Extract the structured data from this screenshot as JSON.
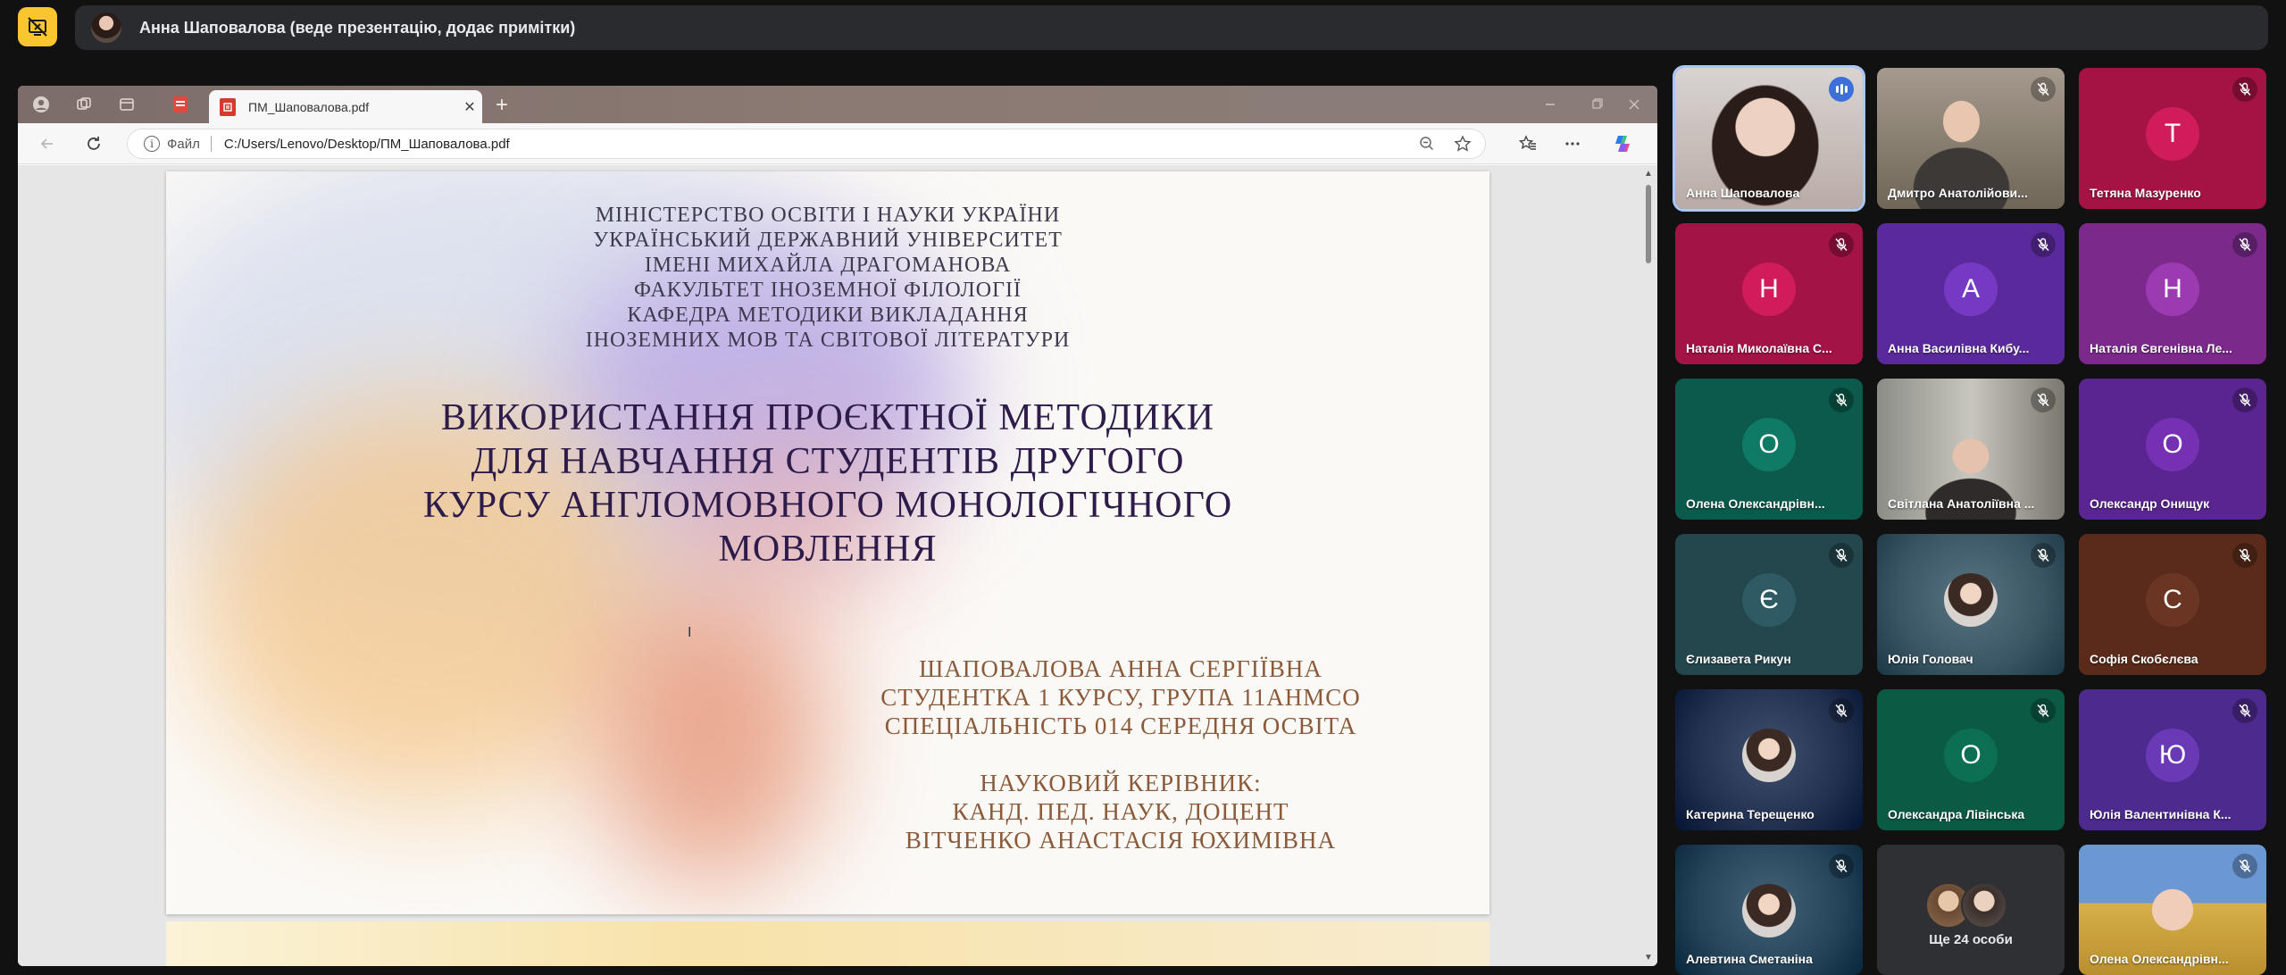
{
  "presenter_bar": {
    "text": "Анна Шаповалова (веде презентацію, додає примітки)"
  },
  "browser": {
    "tab_title": "ПМ_Шаповалова.pdf",
    "tab_close": "✕",
    "new_tab": "+",
    "address": {
      "scheme_label": "Файл",
      "url": "C:/Users/Lenovo/Desktop/ПМ_Шаповалова.pdf"
    }
  },
  "pdf": {
    "institution_lines": [
      "МІНІСТЕРСТВО ОСВІТИ І НАУКИ УКРАЇНИ",
      "УКРАЇНСЬКИЙ ДЕРЖАВНИЙ УНІВЕРСИТЕТ",
      "ІМЕНІ МИХАЙЛА ДРАГОМАНОВА",
      "ФАКУЛЬТЕТ ІНОЗЕМНОЇ ФІЛОЛОГІЇ",
      "КАФЕДРА МЕТОДИКИ ВИКЛАДАННЯ",
      "ІНОЗЕМНИХ МОВ ТА СВІТОВОЇ ЛІТЕРАТУРИ"
    ],
    "title_lines": [
      "ВИКОРИСТАННЯ ПРОЄКТНОЇ МЕТОДИКИ",
      "ДЛЯ НАВЧАННЯ СТУДЕНТІВ ДРУГОГО",
      "КУРСУ АНГЛОМОВНОГО МОНОЛОГІЧНОГО",
      "МОВЛЕННЯ"
    ],
    "author_lines": [
      "ШАПОВАЛОВА АННА СЕРГІЇВНА",
      "СТУДЕНТКА 1 КУРСУ, ГРУПА 11АНМСО",
      "СПЕЦІАЛЬНІСТЬ 014 СЕРЕДНЯ ОСВІТА"
    ],
    "supervisor_lines": [
      "НАУКОВИЙ КЕРІВНИК:",
      "КАНД. ПЕД. НАУК, ДОЦЕНТ",
      "ВІТЧЕНКО АНАСТАСІЯ ЮХИМІВНА"
    ]
  },
  "participants": [
    {
      "name": "Анна Шаповалова",
      "initial": "",
      "bg": "#c8bdb6",
      "speaking": true,
      "muted": false
    },
    {
      "name": "Дмитро Анатолійови...",
      "initial": "",
      "bg": "#8c8478",
      "speaking": false,
      "muted": true
    },
    {
      "name": "Тетяна Мазуренко",
      "initial": "Т",
      "bg": "#a41344",
      "avatar_bg": "#d01c5a",
      "speaking": false,
      "muted": true
    },
    {
      "name": "Наталія Миколаївна С...",
      "initial": "Н",
      "bg": "#a31346",
      "avatar_bg": "#d01c5a",
      "speaking": false,
      "muted": true
    },
    {
      "name": "Анна Василівна Кибу...",
      "initial": "А",
      "bg": "#5a2a9c",
      "avatar_bg": "#7639c4",
      "speaking": false,
      "muted": true
    },
    {
      "name": "Наталія Євгенівна Ле...",
      "initial": "Н",
      "bg": "#7b2a8c",
      "avatar_bg": "#9c3ab2",
      "speaking": false,
      "muted": true
    },
    {
      "name": "Олена Олександрівн...",
      "initial": "О",
      "bg": "#0b5a4c",
      "avatar_bg": "#0f7a66",
      "speaking": false,
      "muted": true
    },
    {
      "name": "Світлана Анатоліївна ...",
      "initial": "",
      "bg": "#6e6a66",
      "speaking": false,
      "muted": true
    },
    {
      "name": "Олександр Онищук",
      "initial": "О",
      "bg": "#5a2590",
      "avatar_bg": "#7530b4",
      "speaking": false,
      "muted": true
    },
    {
      "name": "Єлизавета Рикун",
      "initial": "Є",
      "bg": "#24474e",
      "avatar_bg": "#2e5b63",
      "speaking": false,
      "muted": true
    },
    {
      "name": "Юлія Головач",
      "initial": "",
      "bg": "#3a5563",
      "speaking": false,
      "muted": true
    },
    {
      "name": "Софія Скобєлєва",
      "initial": "С",
      "bg": "#5a2b1a",
      "avatar_bg": "#6b3524",
      "speaking": false,
      "muted": true
    },
    {
      "name": "Катерина Терещенко",
      "initial": "",
      "bg": "#233150",
      "speaking": false,
      "muted": true
    },
    {
      "name": "Олександра Лівінська",
      "initial": "О",
      "bg": "#0a5a44",
      "avatar_bg": "#0c6e53",
      "speaking": false,
      "muted": true
    },
    {
      "name": "Юлія Валентинівна К...",
      "initial": "Ю",
      "bg": "#4d2a8e",
      "avatar_bg": "#6a3ab6",
      "speaking": false,
      "muted": true
    },
    {
      "name": "Алевтина Сметаніна",
      "initial": "",
      "bg": "#25445a",
      "speaking": false,
      "muted": true
    },
    {
      "name": "Ще 24 особи",
      "initial": "",
      "bg": "#2f3033",
      "speaking": false,
      "muted": false,
      "overflow": true
    },
    {
      "name": "Олена Олександрівн...",
      "initial": "",
      "bg": "#5c87c4",
      "speaking": false,
      "muted": true
    }
  ],
  "icons": {
    "stop_share": "present-off-icon",
    "mute": "mic-off-icon",
    "speaking": "audio-level-icon"
  },
  "colors": {
    "accent_yellow": "#f9c630",
    "speaking_blue": "#3c6fd8"
  }
}
